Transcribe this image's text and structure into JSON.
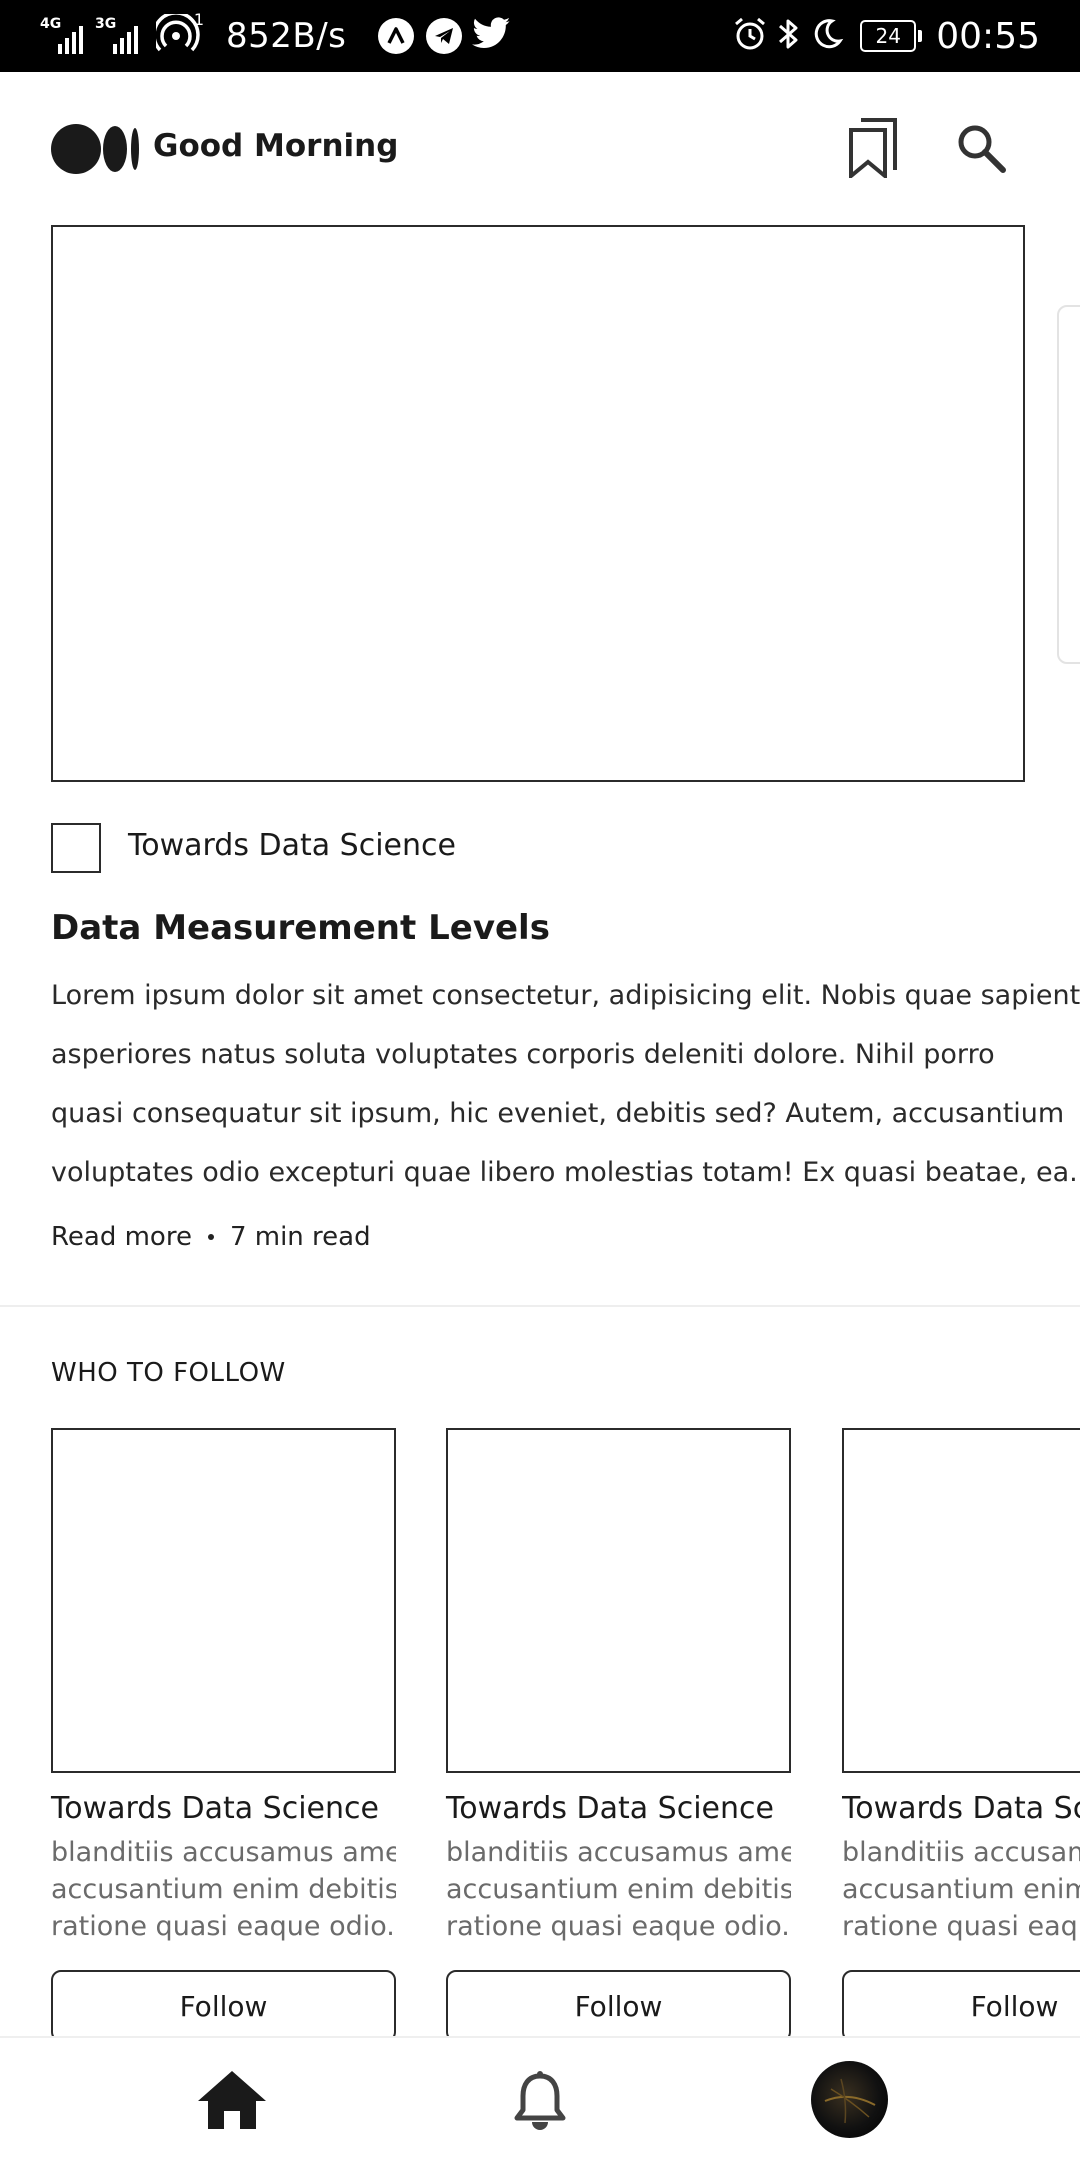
{
  "status_bar": {
    "network_1": "4G",
    "network_2": "3G",
    "hotspot_count": "1",
    "net_speed": "852B/s",
    "battery": "24",
    "time": "00:55",
    "icons": [
      "signal-4g-icon",
      "signal-3g-icon",
      "hotspot-icon",
      "app-a-icon",
      "telegram-icon",
      "twitter-icon",
      "alarm-icon",
      "bluetooth-icon",
      "moon-icon",
      "battery-icon"
    ]
  },
  "header": {
    "greeting": "Good Morning",
    "icons": [
      "medium-logo",
      "bookmark-icon",
      "search-icon"
    ]
  },
  "article": {
    "publication": "Towards Data Science",
    "title": "Data Measurement Levels",
    "excerpt_lines": [
      "Lorem ipsum dolor sit amet consectetur, adipisicing elit. Nobis quae sapiente",
      "asperiores natus soluta voluptates corporis deleniti dolore. Nihil porro",
      "quasi consequatur sit ipsum, hic eveniet, debitis sed? Autem, accusantium",
      "voluptates odio excepturi quae libero molestias totam! Ex quasi beatae, ea..."
    ],
    "read_more": "Read more",
    "read_time": "7 min read"
  },
  "who_to_follow": {
    "label": "WHO TO FOLLOW",
    "cards": [
      {
        "name": "Towards Data Science",
        "desc_lines": [
          "blanditiis accusamus amet",
          "accusantium enim debitis",
          "ratione quasi eaque odio..."
        ],
        "button": "Follow"
      },
      {
        "name": "Towards Data Science",
        "desc_lines": [
          "blanditiis accusamus amet",
          "accusantium enim debitis",
          "ratione quasi eaque odio..."
        ],
        "button": "Follow"
      },
      {
        "name": "Towards Data Science",
        "desc_lines": [
          "blanditiis accusamus amet",
          "accusantium enim debitis",
          "ratione quasi eaque odio..."
        ],
        "button": "Follow"
      }
    ]
  },
  "bottom_nav": {
    "items": [
      "home-icon",
      "bell-icon",
      "avatar"
    ]
  }
}
